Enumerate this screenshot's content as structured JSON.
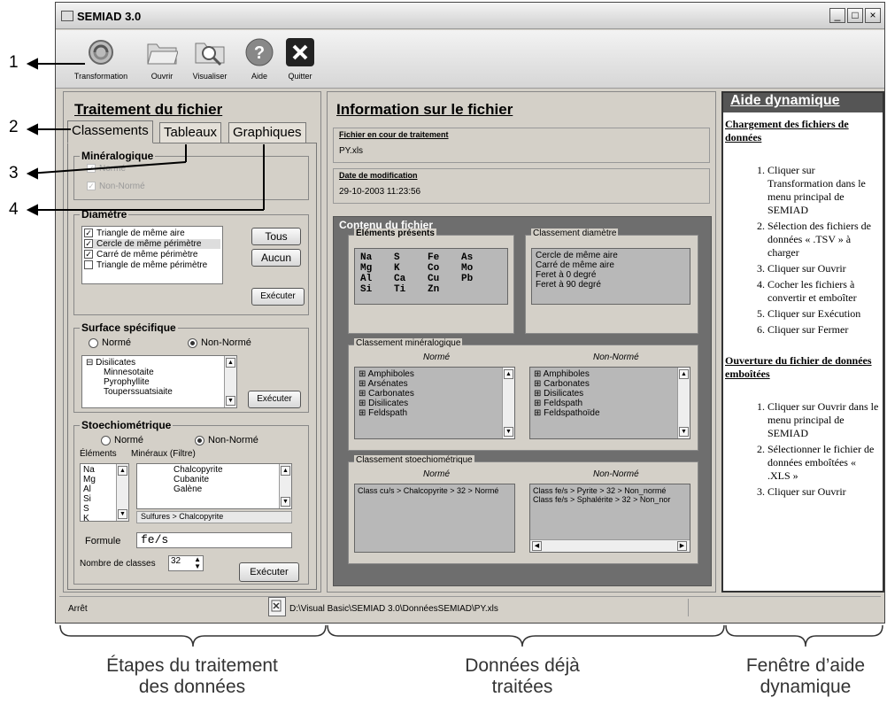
{
  "app": {
    "title": "SEMIAD 3.0"
  },
  "toolbar": [
    {
      "label": "Transformation",
      "icon": "transform-icon"
    },
    {
      "label": "Ouvrir",
      "icon": "folder-icon"
    },
    {
      "label": "Visualiser",
      "icon": "magnifier-folder-icon"
    },
    {
      "label": "Aide",
      "icon": "help-icon"
    },
    {
      "label": "Quitter",
      "icon": "close-icon"
    }
  ],
  "callouts": [
    "1",
    "2",
    "3",
    "4"
  ],
  "left": {
    "header": "Traitement du fichier",
    "tabs": [
      "Classements",
      "Tableaux",
      "Graphiques"
    ],
    "mineralogique": {
      "title": "Minéralogique",
      "options": [
        "Normé",
        "Non-Normé"
      ]
    },
    "diametre": {
      "title": "Diamètre",
      "items": [
        "Triangle de même aire",
        "Cercle de même périmètre",
        "Carré de même périmètre",
        "Triangle de même périmètre"
      ],
      "checked": [
        true,
        true,
        true,
        false
      ],
      "btn_tous": "Tous",
      "btn_aucun": "Aucun",
      "btn_exec": "Exécuter"
    },
    "surface": {
      "title": "Surface spécifique",
      "radio1": "Normé",
      "radio2": "Non-Normé",
      "tree": [
        "Disilicates",
        "Minnesotaite",
        "Pyrophyllite",
        "Touperssuatsiaite"
      ],
      "btn_exec": "Exécuter"
    },
    "stoech": {
      "title": "Stoechiométrique",
      "radio1": "Normé",
      "radio2": "Non-Normé",
      "col1": "Éléments",
      "col2": "Minéraux (Filtre)",
      "elements": [
        "Na",
        "Mg",
        "Al",
        "Si",
        "S",
        "K"
      ],
      "minerals": [
        "Chalcopyrite",
        "Cubanite",
        "Galène"
      ],
      "path": "Sulfures > Chalcopyrite",
      "formule_label": "Formule",
      "formule_value": "fe/s",
      "classes_label": "Nombre de classes",
      "classes_value": "32",
      "btn_exec": "Exécuter"
    }
  },
  "middle": {
    "header": "Information sur le fichier",
    "fichier_label": "Fichier en cour de traitement",
    "fichier_value": "PY.xls",
    "date_label": "Date de modification",
    "date_value": "29-10-2003 11:23:56",
    "contenu_title": "Contenu du fichier",
    "elements_title": "Éléments présents",
    "elements_rows": [
      [
        "Na",
        "S",
        "Fe",
        "As"
      ],
      [
        "Mg",
        "K",
        "Co",
        "Mo"
      ],
      [
        "Al",
        "Ca",
        "Cu",
        "Pb"
      ],
      [
        "Si",
        "Ti",
        "Zn",
        ""
      ]
    ],
    "diam_title": "Classement diamètre",
    "diam_items": [
      "Cercle de même aire",
      "Carré de même aire",
      "Feret à 0 degré",
      "Feret à 90 degré"
    ],
    "min_title": "Classement minéralogique",
    "norme": "Normé",
    "non_norme": "Non-Normé",
    "min_norme": [
      "Amphiboles",
      "Arsénates",
      "Carbonates",
      "Disilicates",
      "Feldspath"
    ],
    "min_non_norme": [
      "Amphiboles",
      "Carbonates",
      "Disilicates",
      "Feldspath",
      "Feldspathoïde"
    ],
    "stoech_title": "Classement stoechiométrique",
    "stoech_norme": [
      "Class cu/s > Chalcopyrite > 32 > Normé"
    ],
    "stoech_non_norme": [
      "Class fe/s > Pyrite > 32 > Non_normé",
      "Class fe/s > Sphalérite > 32 > Non_nor"
    ]
  },
  "help": {
    "header": "Aide dynamique",
    "sec1_title": "Chargement des fichiers de données",
    "sec1_items": [
      "Cliquer sur Transformation dans le menu principal de SEMIAD",
      "Sélection des fichiers de données « .TSV » à charger",
      "Cliquer sur Ouvrir",
      "Cocher les fichiers à convertir et emboîter",
      "Cliquer sur Exécution",
      "Cliquer sur Fermer"
    ],
    "sec2_title": "Ouverture du fichier de données emboîtées",
    "sec2_items": [
      "Cliquer sur Ouvrir dans le menu principal de SEMIAD",
      "Sélectionner le fichier de données emboîtées « .XLS »",
      "Cliquer sur Ouvrir"
    ]
  },
  "status": {
    "left": "Arrêt",
    "path": "D:\\Visual Basic\\SEMIAD 3.0\\DonnéesSEMIAD\\PY.xls"
  },
  "bottom": {
    "label1": "Étapes du traitement des données",
    "label2": "Données déjà traitées",
    "label3": "Fenêtre d’aide dynamique"
  }
}
